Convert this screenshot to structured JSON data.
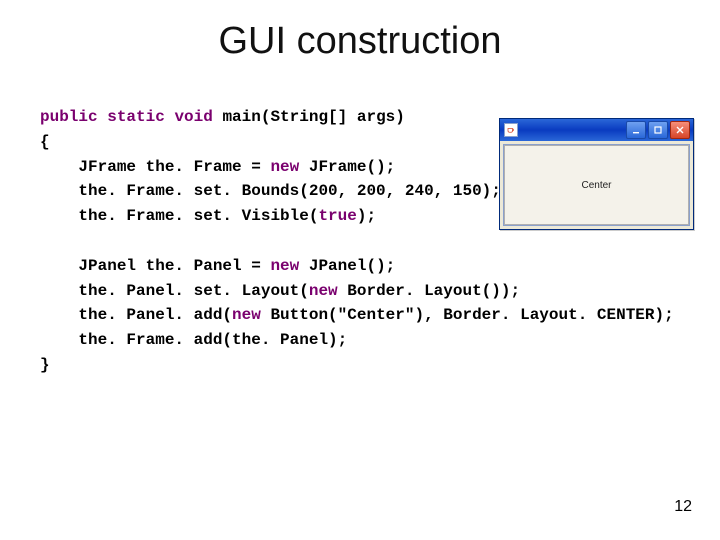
{
  "title": "GUI construction",
  "page_number": "12",
  "code": {
    "l1": {
      "kw1": "public",
      "sp1": " ",
      "kw2": "static",
      "sp2": " ",
      "kw3": "void",
      "rest": " main(String[] args)"
    },
    "l2": "{",
    "l3a": "JFrame the. Frame = ",
    "l3kw": "new",
    "l3b": " JFrame();",
    "l4": "the. Frame. set. Bounds(200, 200, 240, 150);",
    "l5a": "the. Frame. set. Visible(",
    "l5kw": "true",
    "l5b": ");",
    "l6a": "JPanel the. Panel = ",
    "l6kw": "new",
    "l6b": " JPanel();",
    "l7a": "the. Panel. set. Layout(",
    "l7kw": "new",
    "l7b": " Border. Layout());",
    "l8a": "the. Panel. add(",
    "l8kw": "new",
    "l8b": " Button(\"Center\"), Border. Layout. CENTER);",
    "l9": "the. Frame. add(the. Panel);",
    "l10": "}"
  },
  "jframe": {
    "center_label": "Center"
  }
}
